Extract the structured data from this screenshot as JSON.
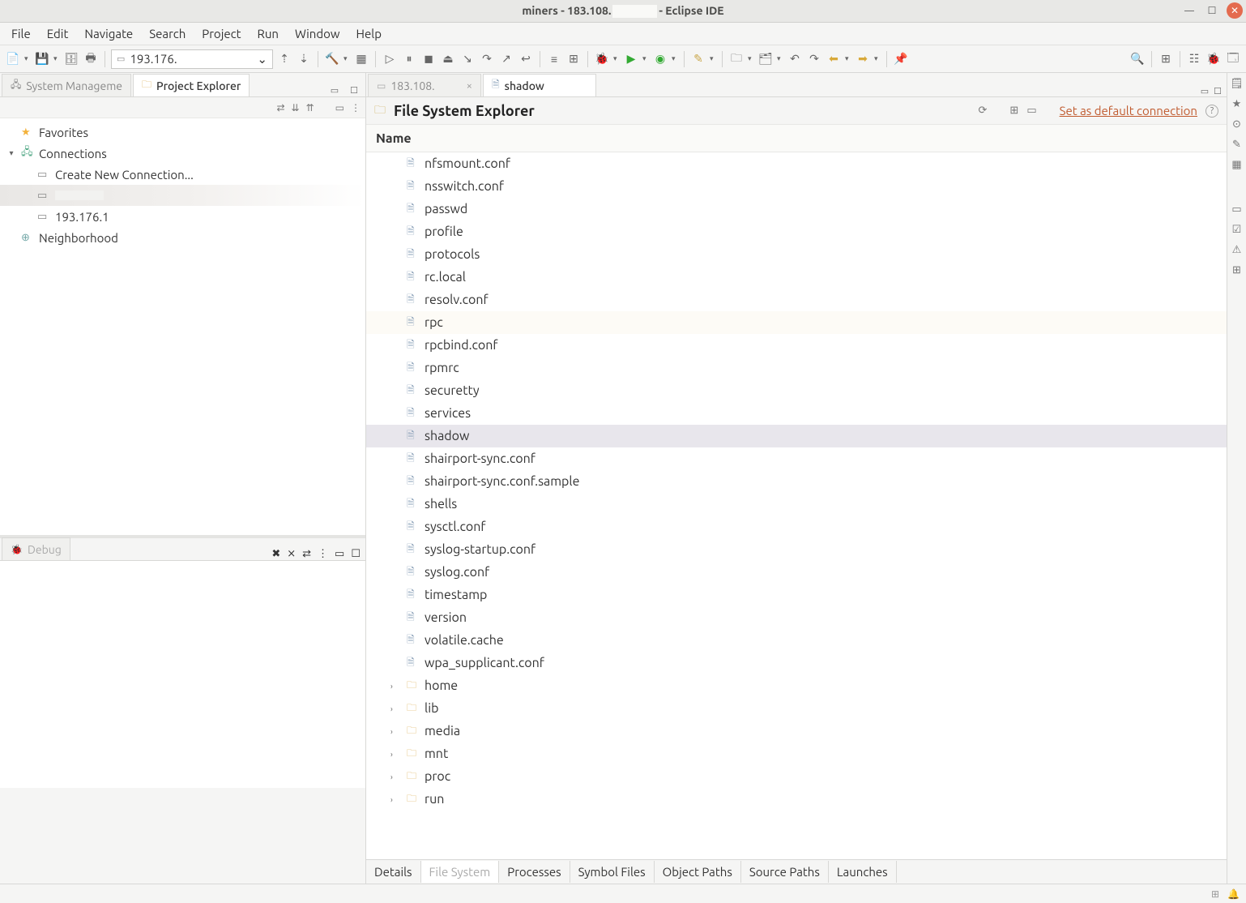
{
  "window": {
    "title_prefix": "miners - 183.108.",
    "title_suffix": "- Eclipse IDE"
  },
  "menu": [
    "File",
    "Edit",
    "Navigate",
    "Search",
    "Project",
    "Run",
    "Window",
    "Help"
  ],
  "toolbar": {
    "address": "193.176."
  },
  "left": {
    "tabs": {
      "inactive": "System Manageme",
      "active": "Project Explorer"
    },
    "tree": {
      "favorites": "Favorites",
      "connections": "Connections",
      "create": "Create New Connection...",
      "host_a_blur": "",
      "host_b": "193.176.1",
      "neighborhood": "Neighborhood"
    },
    "debug_tab": "Debug"
  },
  "editor": {
    "tabs": {
      "inactive": "183.108.",
      "active": "shadow"
    },
    "fse_title": "File System Explorer",
    "default_link": "Set as default connection",
    "col_name": "Name"
  },
  "files": [
    {
      "name": "nfsmount.conf",
      "type": "file"
    },
    {
      "name": "nsswitch.conf",
      "type": "file"
    },
    {
      "name": "passwd",
      "type": "file"
    },
    {
      "name": "profile",
      "type": "file"
    },
    {
      "name": "protocols",
      "type": "file"
    },
    {
      "name": "rc.local",
      "type": "file"
    },
    {
      "name": "resolv.conf",
      "type": "file"
    },
    {
      "name": "rpc",
      "type": "file",
      "hl": true
    },
    {
      "name": "rpcbind.conf",
      "type": "file"
    },
    {
      "name": "rpmrc",
      "type": "file"
    },
    {
      "name": "securetty",
      "type": "file"
    },
    {
      "name": "services",
      "type": "file"
    },
    {
      "name": "shadow",
      "type": "file",
      "selected": true
    },
    {
      "name": "shairport-sync.conf",
      "type": "file"
    },
    {
      "name": "shairport-sync.conf.sample",
      "type": "file"
    },
    {
      "name": "shells",
      "type": "file"
    },
    {
      "name": "sysctl.conf",
      "type": "file"
    },
    {
      "name": "syslog-startup.conf",
      "type": "file"
    },
    {
      "name": "syslog.conf",
      "type": "file"
    },
    {
      "name": "timestamp",
      "type": "file"
    },
    {
      "name": "version",
      "type": "file"
    },
    {
      "name": "volatile.cache",
      "type": "file"
    },
    {
      "name": "wpa_supplicant.conf",
      "type": "file"
    },
    {
      "name": "home",
      "type": "folder"
    },
    {
      "name": "lib",
      "type": "folder"
    },
    {
      "name": "media",
      "type": "folder"
    },
    {
      "name": "mnt",
      "type": "folder"
    },
    {
      "name": "proc",
      "type": "folder"
    },
    {
      "name": "run",
      "type": "folder"
    }
  ],
  "bottom_tabs": [
    "Details",
    "File System",
    "Processes",
    "Symbol Files",
    "Object Paths",
    "Source Paths",
    "Launches"
  ],
  "bottom_active_index": 1
}
